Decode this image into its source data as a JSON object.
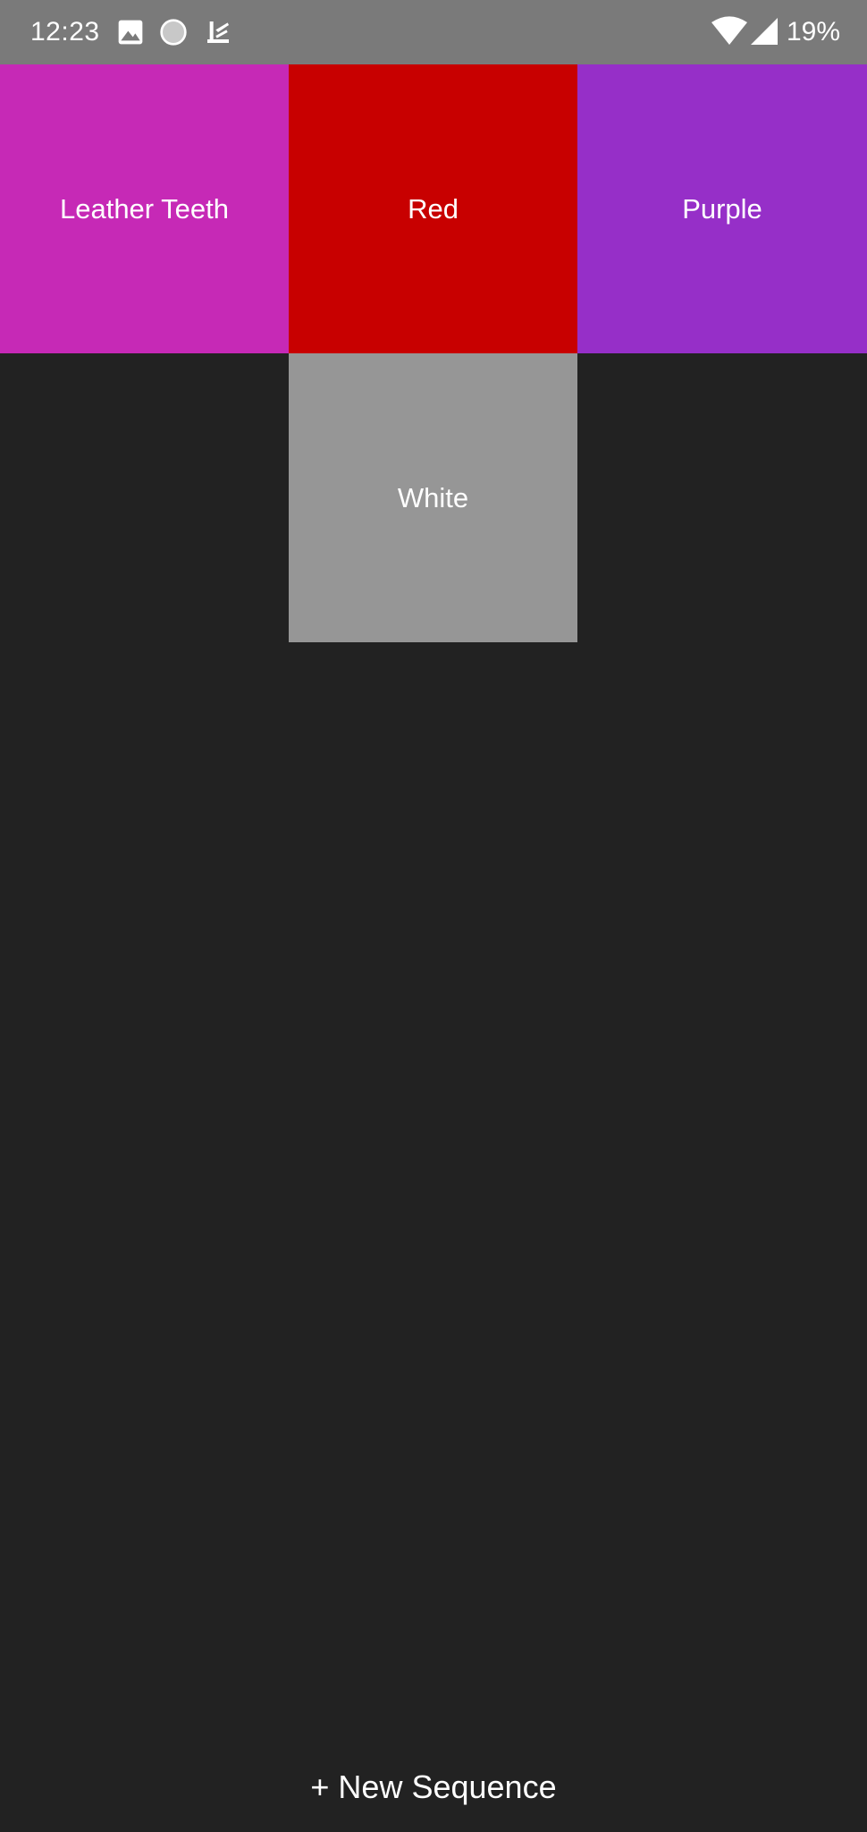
{
  "status_bar": {
    "time": "12:23",
    "battery": "19%",
    "icons": [
      "image-icon",
      "circle-notification-icon",
      "app-notification-icon",
      "wifi-icon",
      "signal-icon"
    ]
  },
  "tiles": [
    {
      "label": "Leather Teeth",
      "color": "#c629b6"
    },
    {
      "label": "Red",
      "color": "#c80000"
    },
    {
      "label": "Purple",
      "color": "#962fc8"
    },
    {
      "label": "White",
      "color": "#969696"
    }
  ],
  "footer": {
    "new_sequence_label": "+ New Sequence"
  },
  "colors": {
    "background": "#222222",
    "status_bar": "#7a7a7a"
  }
}
